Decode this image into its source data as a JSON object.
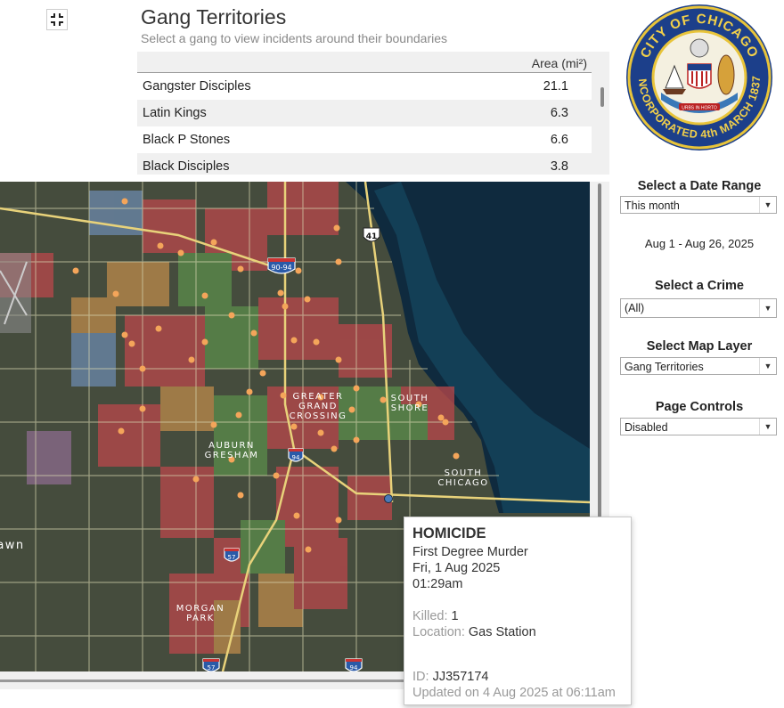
{
  "header": {
    "title": "Gang Territories",
    "subtitle": "Select a gang to view incidents around their boundaries",
    "fullscreen_icon": "collapse-icon"
  },
  "table": {
    "column_header": "Area (mi²)",
    "rows": [
      {
        "name": "Gangster Disciples",
        "area": "21.1"
      },
      {
        "name": "Latin Kings",
        "area": "6.3"
      },
      {
        "name": "Black P Stones",
        "area": "6.6"
      },
      {
        "name": "Black Disciples",
        "area": "3.8"
      }
    ]
  },
  "seal": {
    "text_top": "CITY OF CHICAGO",
    "text_bottom": "INCORPORATED 4th MARCH 1837",
    "motto": "URBS IN HORTO"
  },
  "sidebar": {
    "date_label": "Select a Date Range",
    "date_value": "This month",
    "date_range_text": "Aug 1 - Aug 26, 2025",
    "crime_label": "Select a Crime",
    "crime_value": "(All)",
    "layer_label": "Select Map Layer",
    "layer_value": "Gang Territories",
    "page_label": "Page Controls",
    "page_value": "Disabled"
  },
  "map": {
    "labels": {
      "greater_grand_crossing": [
        "GREATER",
        "GRAND",
        "CROSSING"
      ],
      "south_shore": [
        "SOUTH",
        "SHORE"
      ],
      "auburn_gresham": [
        "AUBURN",
        "GRESHAM"
      ],
      "south_chicago": [
        "SOUTH",
        "CHICAGO"
      ],
      "morgan_park": [
        "MORGAN",
        "PARK"
      ],
      "lawn_partial": "awn"
    },
    "shields": {
      "i90_94": "90-94",
      "i94": "94",
      "i57_top": "57",
      "i57_bottom": "57",
      "i94_bottom": "94",
      "us41": "41"
    }
  },
  "tooltip": {
    "title": "HOMICIDE",
    "description": "First Degree Murder",
    "date": "Fri, 1 Aug 2025",
    "time": "01:29am",
    "killed_label": "Killed:",
    "killed_value": "1",
    "location_label": "Location:",
    "location_value": "Gas Station",
    "id_label": "ID:",
    "id_value": "JJ357174",
    "updated": "Updated on 4 Aug 2025 at 06:11am"
  },
  "colors": {
    "territory_red": "#b5474a",
    "territory_green": "#5a8a4a",
    "territory_blue": "#6a86a8",
    "territory_orange": "#b7884a",
    "incident_dot": "#f4a55a",
    "lake": "#0f2a3e"
  }
}
